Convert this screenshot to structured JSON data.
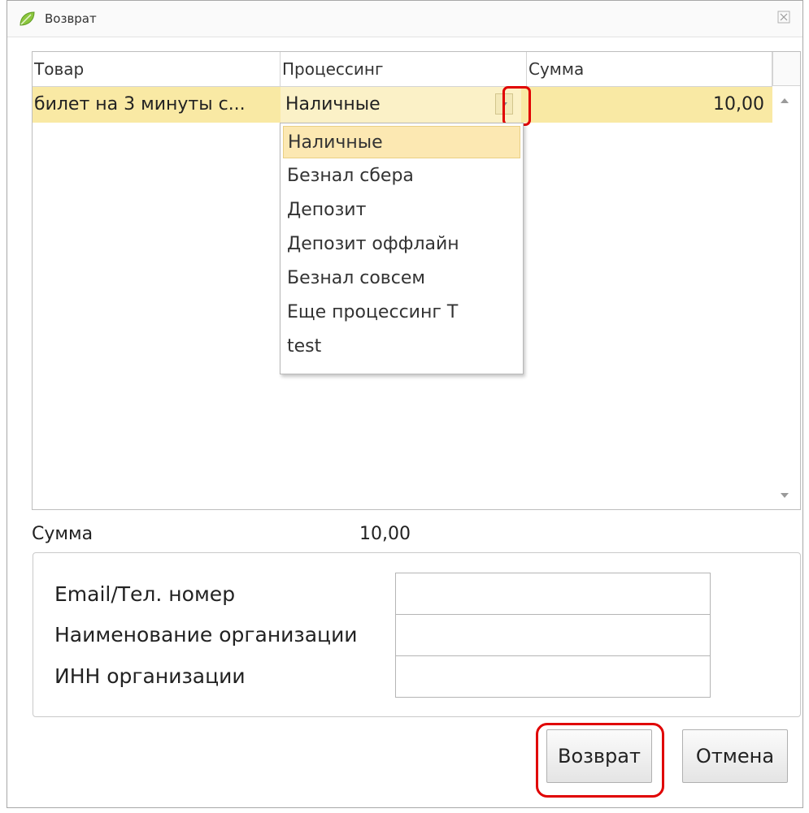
{
  "window": {
    "title": "Возврат",
    "app_icon": "leaf-icon",
    "close_icon": "close-icon"
  },
  "grid": {
    "columns": [
      "Товар",
      "Процессинг",
      "Сумма"
    ],
    "rows": [
      {
        "product": "билет на 3 минуты с...",
        "processing": "Наличные",
        "amount": "10,00"
      }
    ]
  },
  "dropdown": {
    "options": [
      "Наличные",
      "Безнал сбера",
      "Депозит",
      "Депозит оффлайн",
      "Безнал совсем",
      "Еще процессинг Т",
      "test"
    ],
    "selected": "Наличные"
  },
  "summary": {
    "label": "Сумма",
    "value": "10,00"
  },
  "form": {
    "email_label": "Email/Тел. номер",
    "email_value": "",
    "org_name_label": "Наименование организации",
    "org_name_value": "",
    "inn_label": "ИНН организации",
    "inn_value": ""
  },
  "buttons": {
    "return_label": "Возврат",
    "cancel_label": "Отмена"
  },
  "colors": {
    "selection": "#f9e9a4",
    "highlight_ring": "#e00000"
  }
}
